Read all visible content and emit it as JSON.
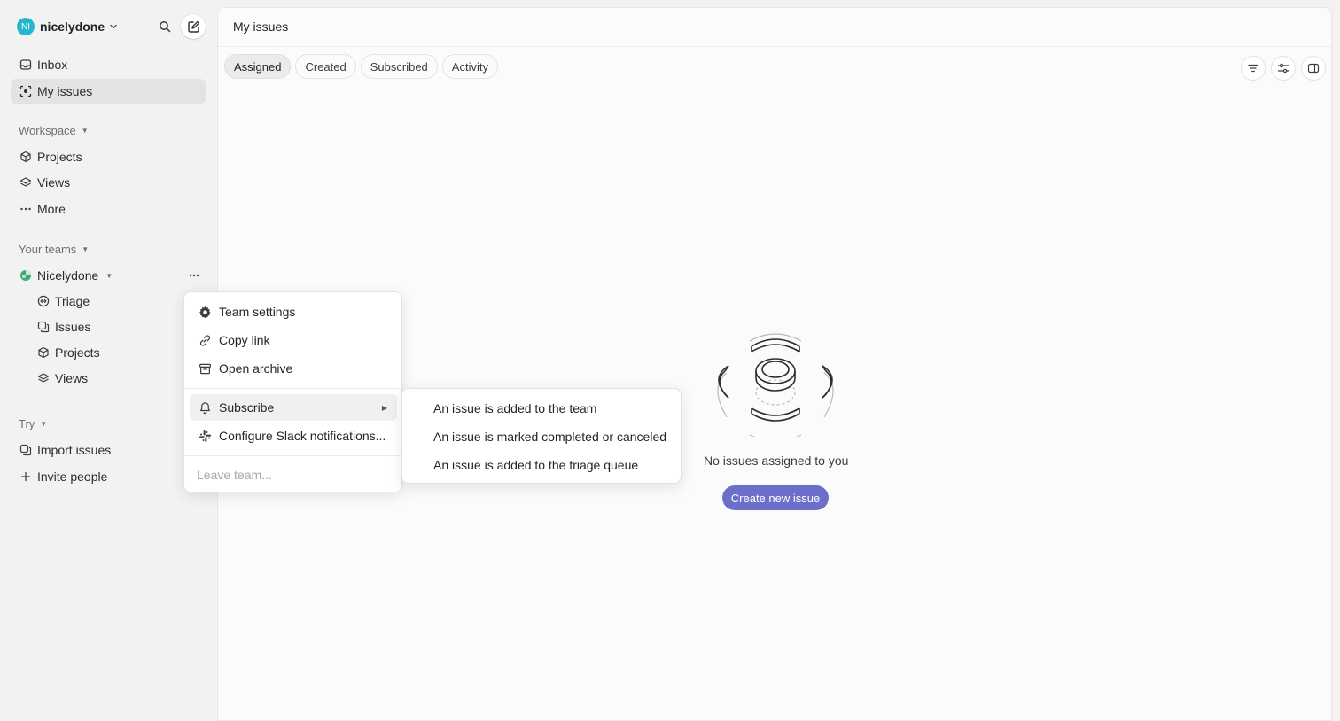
{
  "workspace": {
    "initials": "NI",
    "name": "nicelydone"
  },
  "nav": {
    "inbox": "Inbox",
    "my_issues": "My issues"
  },
  "workspace_section": {
    "label": "Workspace",
    "items": [
      "Projects",
      "Views",
      "More"
    ]
  },
  "teams_section": {
    "label": "Your teams",
    "team_name": "Nicelydone",
    "items": [
      "Triage",
      "Issues",
      "Projects",
      "Views"
    ]
  },
  "try_section": {
    "label": "Try",
    "items": [
      "Import issues",
      "Invite people"
    ]
  },
  "main": {
    "title": "My issues",
    "tabs": [
      "Assigned",
      "Created",
      "Subscribed",
      "Activity"
    ],
    "active_tab": "Assigned",
    "empty_text": "No issues assigned to you",
    "create_button": "Create new issue"
  },
  "context_menu": {
    "items": [
      "Team settings",
      "Copy link",
      "Open archive",
      "Subscribe",
      "Configure Slack notifications...",
      "Leave team..."
    ]
  },
  "submenu": {
    "items": [
      "An issue is added to the team",
      "An issue is marked completed or canceled",
      "An issue is added to the triage queue"
    ]
  },
  "colors": {
    "accent": "#6c6fc9",
    "avatar": "#26b5ce",
    "team": "#3fa87a"
  }
}
